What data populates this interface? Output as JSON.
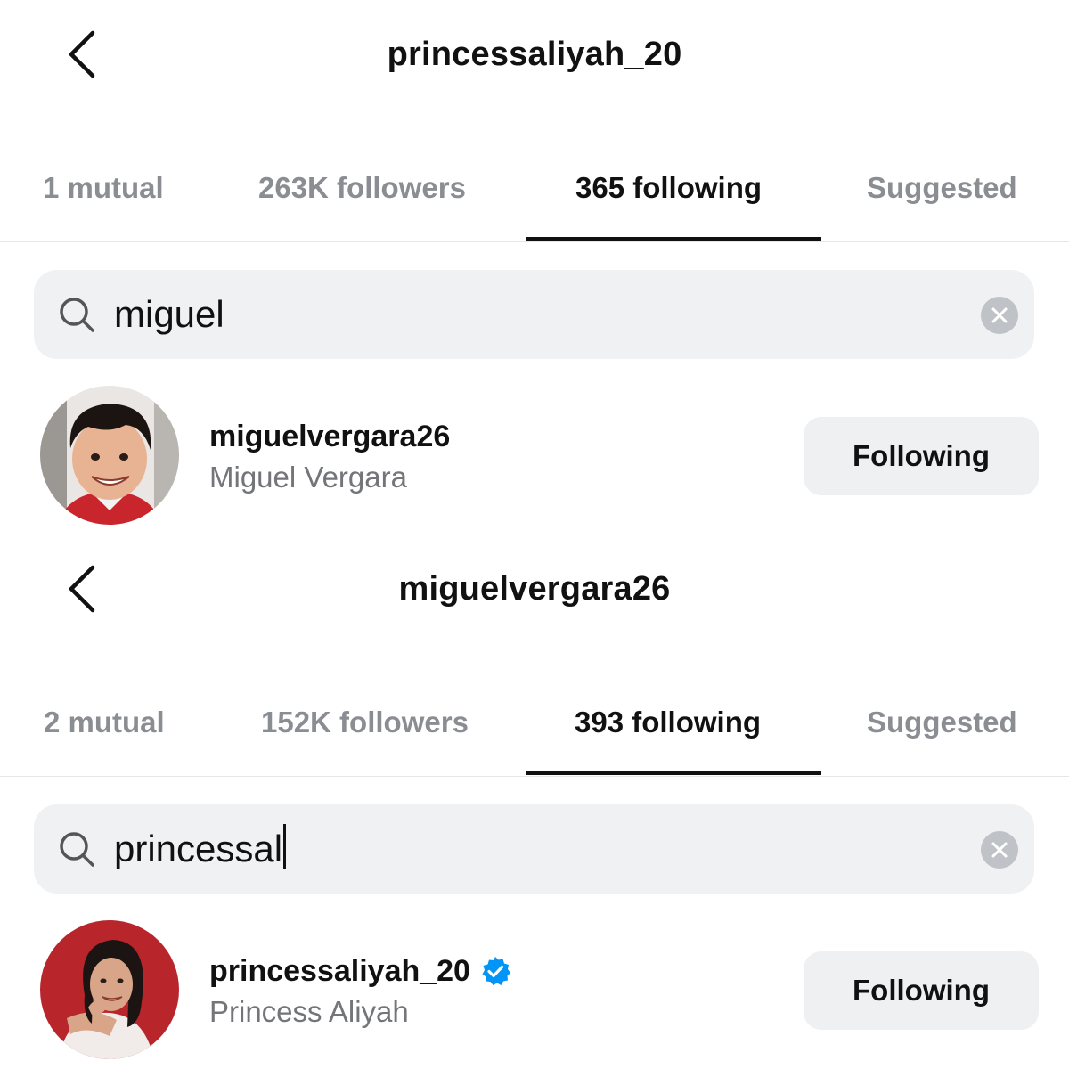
{
  "screens": [
    {
      "header": {
        "title": "princessaliyah_20"
      },
      "tabs": [
        {
          "label": "1 mutual",
          "active": false
        },
        {
          "label": "263K followers",
          "active": false
        },
        {
          "label": "365 following",
          "active": true
        },
        {
          "label": "Suggested",
          "active": false
        }
      ],
      "search": {
        "value": "miguel",
        "cursor": false
      },
      "result": {
        "username": "miguelvergara26",
        "full_name": "Miguel Vergara",
        "verified": false,
        "button_label": "Following",
        "avatar": "avatar-photo-child"
      }
    },
    {
      "header": {
        "title": "miguelvergara26"
      },
      "tabs": [
        {
          "label": "2 mutual",
          "active": false
        },
        {
          "label": "152K followers",
          "active": false
        },
        {
          "label": "393 following",
          "active": true
        },
        {
          "label": "Suggested",
          "active": false
        }
      ],
      "search": {
        "value": "princessal",
        "cursor": true
      },
      "result": {
        "username": "princessaliyah_20",
        "full_name": "Princess Aliyah",
        "verified": true,
        "button_label": "Following",
        "avatar": "avatar-photo-woman"
      }
    }
  ],
  "colors": {
    "text_primary": "#111111",
    "text_secondary": "#737579",
    "tab_inactive": "#8a8d92",
    "search_bg": "#f0f1f3",
    "button_bg": "#eff0f2",
    "verified_blue": "#0095f6",
    "avatar_red_bg": "#b8262c"
  },
  "icons": {
    "back": "chevron-left-icon",
    "search": "search-icon",
    "clear": "clear-icon",
    "verified": "verified-badge-icon"
  }
}
